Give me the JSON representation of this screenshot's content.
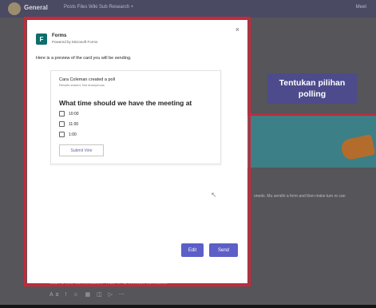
{
  "background": {
    "channel_title": "General",
    "tabs_text": "Posts   Files   Wiki   Sub Research   +",
    "right_text": "Meet",
    "side_text": "oneds. Mu sendiri a form and then make tum re can",
    "compose_placeholder": "Start a new conversation. Type @ to mention someone.",
    "toolbar_icons": "Aɑ ! ☺ ▦ ◫ ▷ ⋯"
  },
  "callout": {
    "text": "Tentukan pilihan polling",
    "bg_color": "#4d4b8c",
    "line_color": "#c8283a"
  },
  "dialog": {
    "close_icon": "×",
    "app_name": "Forms",
    "app_subtitle": "Powered by Microsoft Forms",
    "preview_text": "Here is a preview of the card you will be sending.",
    "card": {
      "creator": "Cara Coleman created a poll",
      "meta": "Results shared, Not anonymous",
      "question": "What time should we have the meeting at",
      "options": [
        "10:00",
        "11:00",
        "1:00"
      ],
      "submit_label": "Submit Vote"
    },
    "edit_label": "Edit",
    "send_label": "Send",
    "accent_color": "#5b5fc7"
  }
}
